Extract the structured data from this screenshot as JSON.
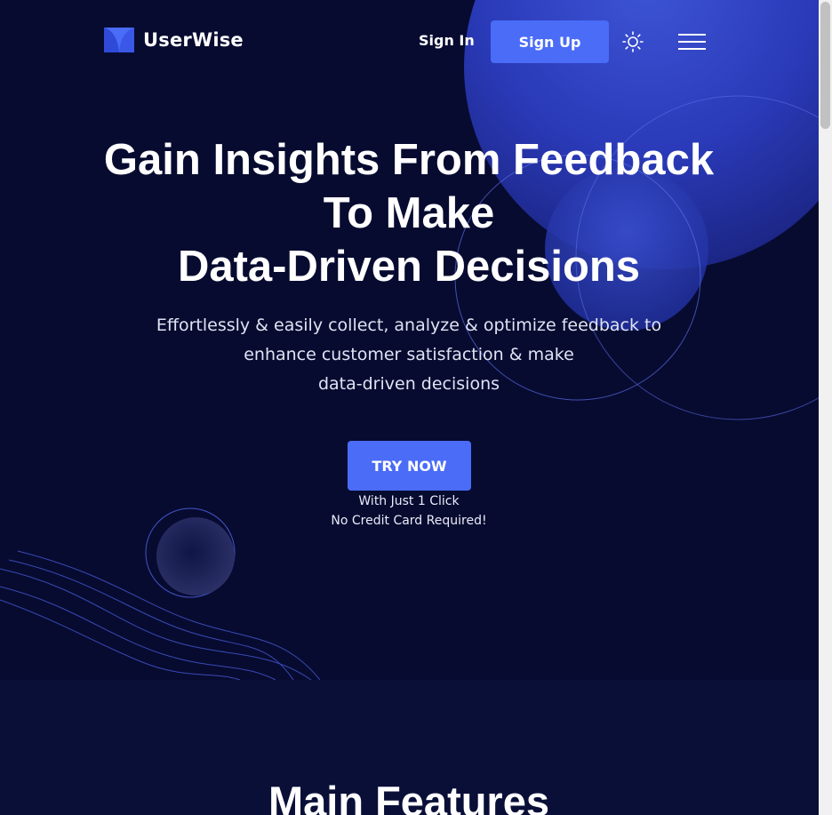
{
  "brand": {
    "name": "UserWise",
    "accent_color": "#4a6cf7",
    "background_color": "#070b30"
  },
  "header": {
    "sign_in_label": "Sign In",
    "sign_up_label": "Sign Up",
    "theme_toggle_icon": "sun-icon",
    "menu_icon": "hamburger-menu-icon"
  },
  "hero": {
    "title_lines": [
      "Gain Insights From Feedback",
      "To Make",
      "Data-Driven Decisions"
    ],
    "subtitle_lines": [
      "Effortlessly & easily collect, analyze & optimize feedback to",
      "enhance customer satisfaction & make",
      "data-driven decisions"
    ],
    "cta_label": "TRY NOW",
    "cta_notes": [
      "With Just 1 Click",
      "No Credit Card Required!"
    ]
  },
  "features": {
    "title": "Main Features"
  }
}
